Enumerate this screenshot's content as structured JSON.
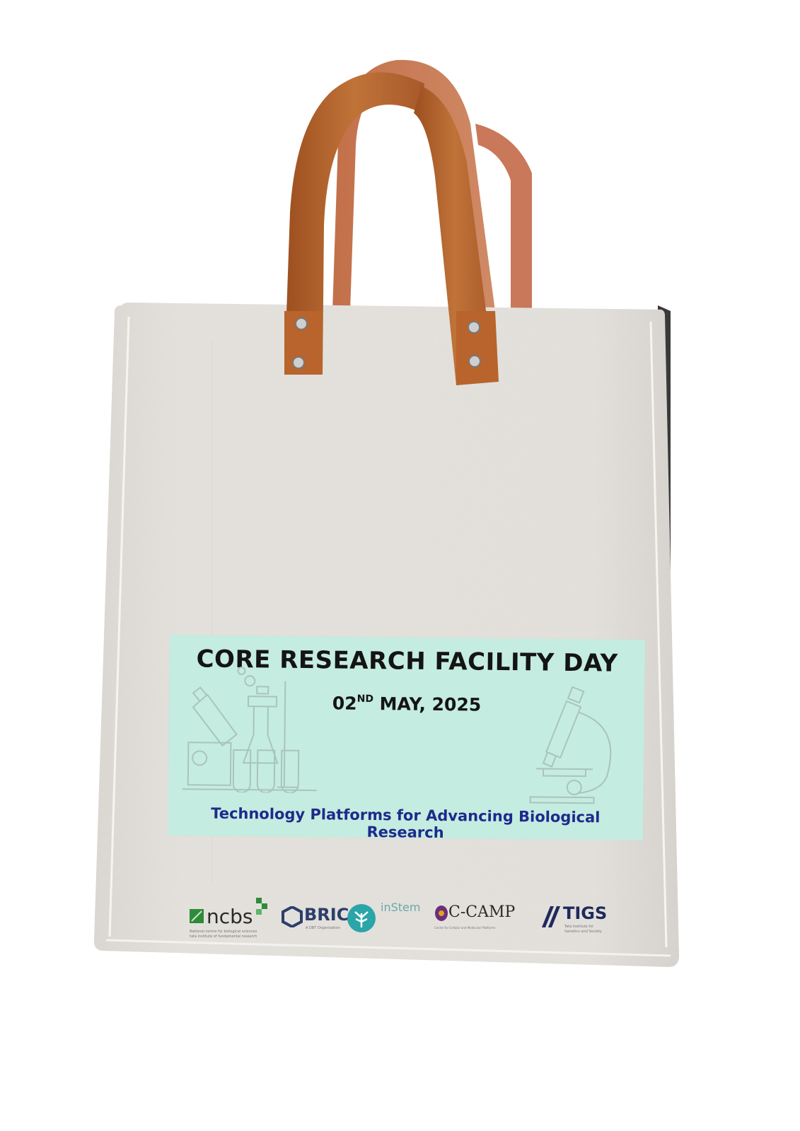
{
  "banner": {
    "title": "CORE RESEARCH FACILITY DAY",
    "date_prefix": "02",
    "date_sup": "ND",
    "date_rest": " MAY, 2025",
    "tagline": "Technology Platforms for Advancing Biological Research"
  },
  "logos": {
    "ncbs": {
      "name": "ncbs",
      "subtitle_1": "National centre for biological sciences",
      "subtitle_2": "tata institute of fundamental research"
    },
    "bric": {
      "name": "BRIC",
      "subtitle": "A DBT Organisation"
    },
    "instem": {
      "name": "inStem"
    },
    "ccamp": {
      "name": "C-CAMP",
      "subtitle": "Centre for Cellular and Molecular Platforms"
    },
    "tigs": {
      "name": "TIGS",
      "subtitle_1": "Tata Institute for",
      "subtitle_2": "Genetics and Society"
    }
  },
  "colors": {
    "background": "#ffffff",
    "felt": "#e6e3de",
    "leather": "#b5652d",
    "banner": "#c5ece0",
    "tagline": "#1e2a8c",
    "title": "#141414",
    "ncbs_green": "#2e8b3a",
    "instem_teal": "#2aa5a8",
    "bric_navy": "#2c3e6b",
    "tigs_navy": "#1f2a5c"
  },
  "icons": [
    "lab-equipment-icon",
    "microscope-icon",
    "rivet-icon"
  ]
}
